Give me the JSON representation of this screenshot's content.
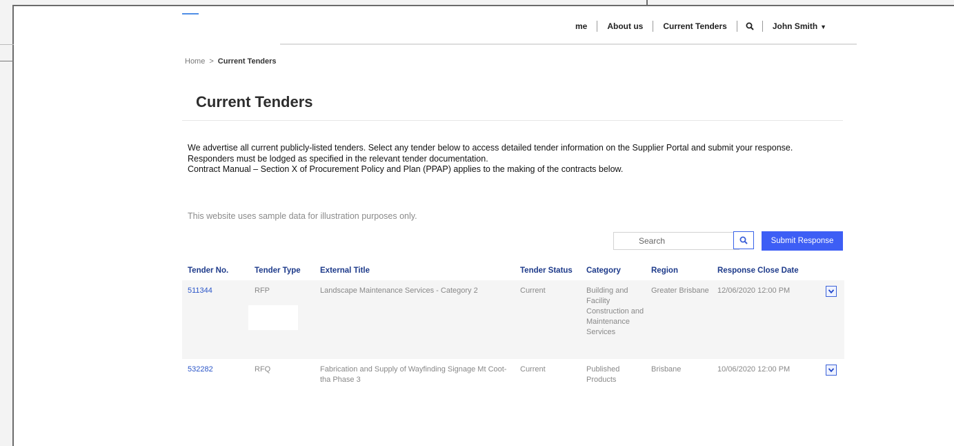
{
  "nav": {
    "items": [
      "me",
      "About us",
      "Current Tenders"
    ],
    "user_name": "John Smith"
  },
  "breadcrumb": {
    "home": "Home",
    "separator": ">",
    "current": "Current Tenders"
  },
  "page": {
    "title": "Current Tenders",
    "intro_lines": [
      "We advertise all current publicly-listed tenders. Select any tender below to access detailed tender information on the Supplier Portal and submit your response.",
      "Responders must be lodged as specified in the relevant tender documentation.",
      "Contract Manual – Section X of Procurement Policy and Plan (PPAP) applies to the making of the contracts below."
    ],
    "sample_note": "This website uses sample data for illustration purposes only."
  },
  "search": {
    "placeholder": "Search"
  },
  "submit_label": "Submit Response",
  "table": {
    "headers": [
      "Tender No.",
      "Tender Type",
      "External Title",
      "Tender Status",
      "Category",
      "Region",
      "Response Close Date"
    ],
    "rows": [
      {
        "tender_no": "511344",
        "type": "RFP",
        "title": "Landscape Maintenance Services - Category 2",
        "status": "Current",
        "category": "Building and Facility Construction and Maintenance Services",
        "region": "Greater Brisbane",
        "close_date": "12/06/2020 12:00 PM"
      },
      {
        "tender_no": "532282",
        "type": "RFQ",
        "title": "Fabrication and Supply of Wayfinding Signage Mt Coot-tha Phase 3",
        "status": "Current",
        "category": "Published Products",
        "region": "Brisbane",
        "close_date": "10/06/2020 12:00 PM"
      }
    ]
  },
  "colors": {
    "accent": "#3d5ef5",
    "header_text": "#1d3a8a",
    "link": "#2a55c8"
  },
  "icons": {
    "search": "search-icon",
    "expand": "chevron-down-icon",
    "user_menu": "caret-down-icon"
  }
}
